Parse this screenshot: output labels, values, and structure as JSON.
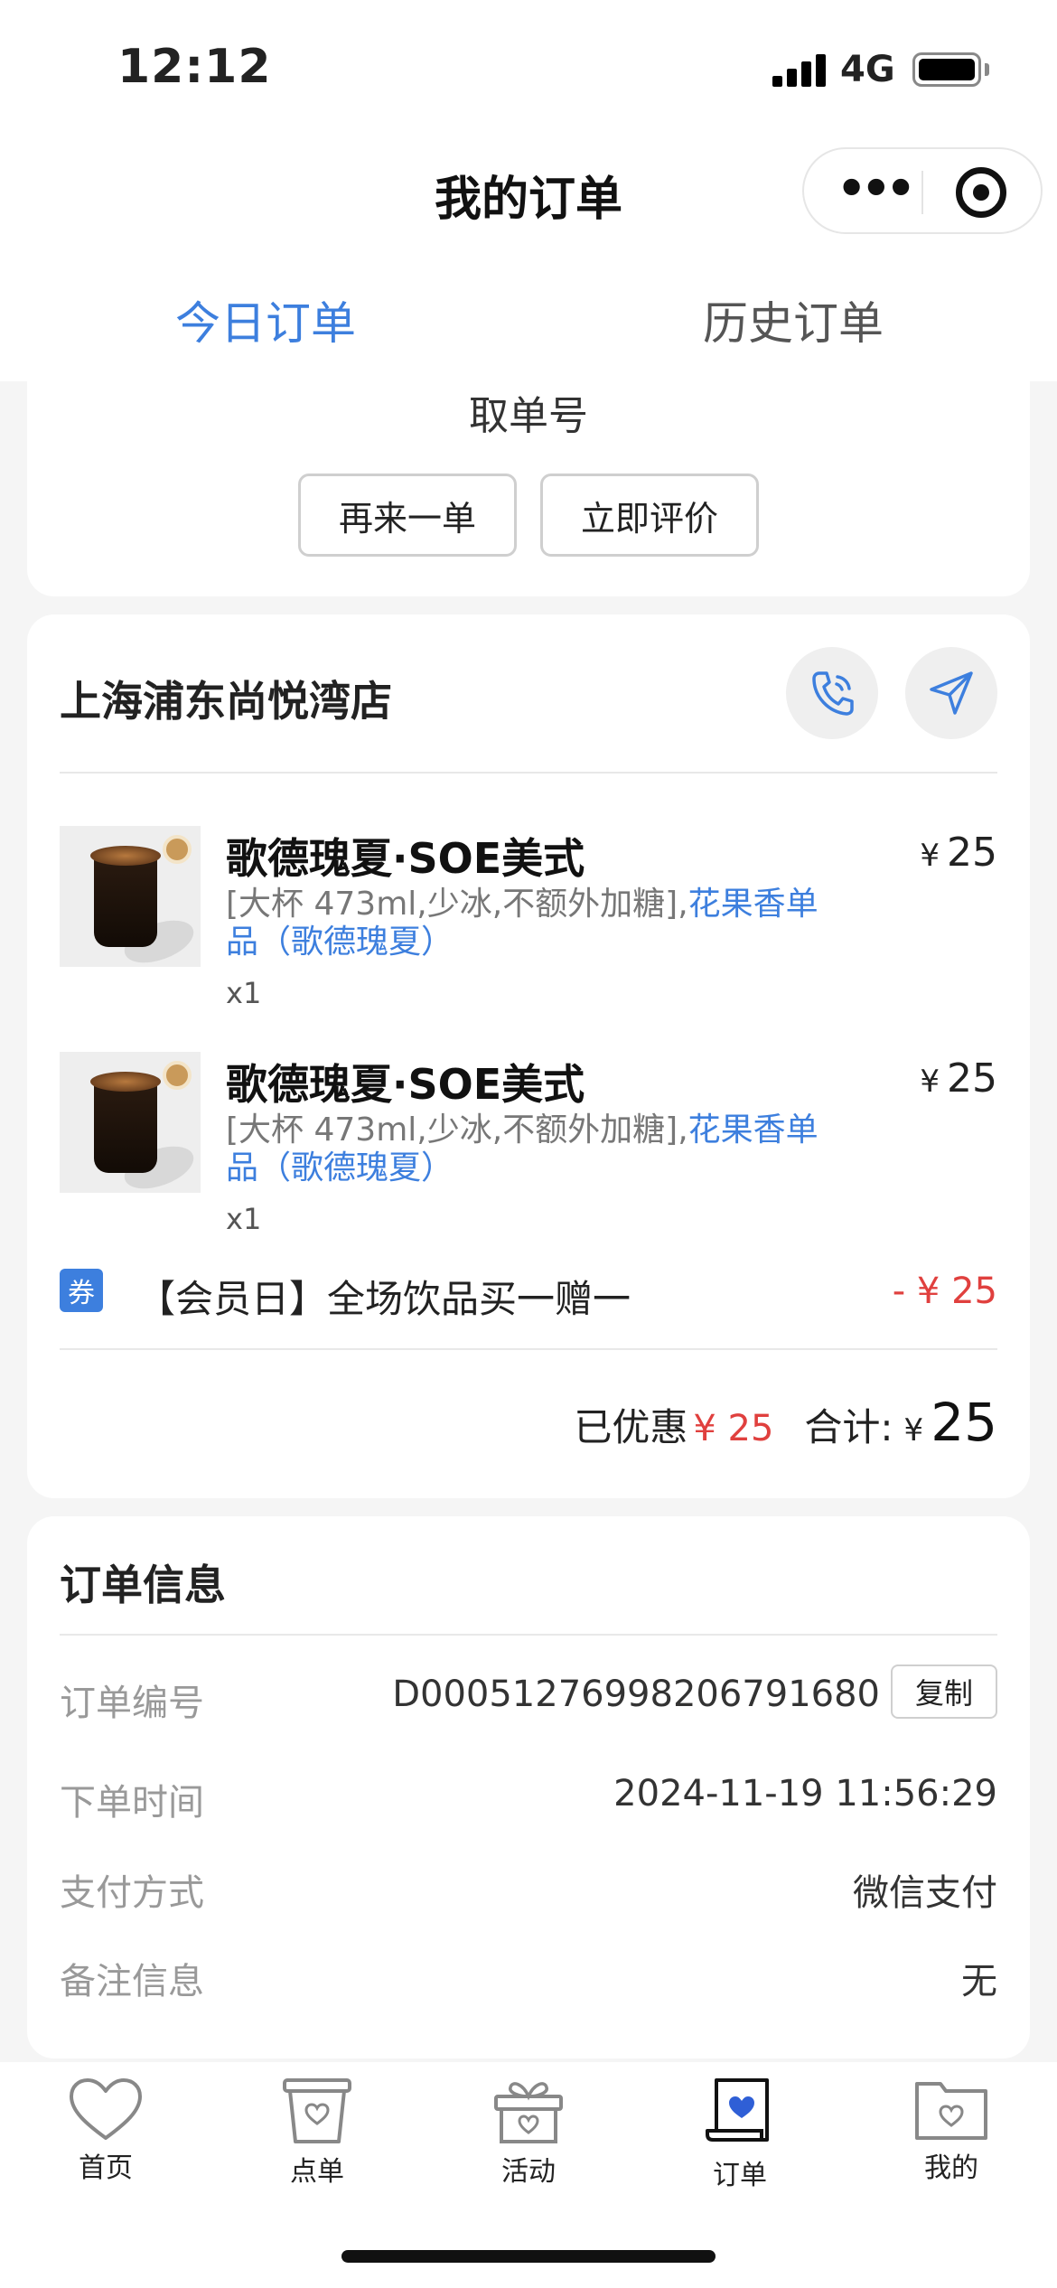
{
  "status_bar": {
    "time": "12:12",
    "network": "4G"
  },
  "nav": {
    "title": "我的订单"
  },
  "tabs": [
    {
      "label": "今日订单",
      "active": true
    },
    {
      "label": "历史订单",
      "active": false
    }
  ],
  "pickup": {
    "label": "取单号",
    "reorder_label": "再来一单",
    "review_label": "立即评价"
  },
  "store": {
    "name": "上海浦东尚悦湾店",
    "phone_icon": "phone-icon",
    "navigate_icon": "navigation-arrow-icon"
  },
  "items": [
    {
      "name": "歌德瑰夏·SOE美式",
      "price_symbol": "¥",
      "price": "25",
      "spec_prefix": "[大杯 473ml,少冰,不额外加糖],",
      "spec_highlight": "花果香单品（歌德瑰夏）",
      "qty": "x1"
    },
    {
      "name": "歌德瑰夏·SOE美式",
      "price_symbol": "¥",
      "price": "25",
      "spec_prefix": "[大杯 473ml,少冰,不额外加糖],",
      "spec_highlight": "花果香单品（歌德瑰夏）",
      "qty": "x1"
    }
  ],
  "coupon": {
    "tag": "券",
    "name": "【会员日】全场饮品买一赠一",
    "amount": "- ¥ 25"
  },
  "summary": {
    "discount_label": "已优惠",
    "discount_value": "¥ 25",
    "total_label": "合计:",
    "total_symbol": "¥",
    "total_value": "25"
  },
  "order_info": {
    "title": "订单信息",
    "rows": [
      {
        "key": "订单编号",
        "value": "D00051276998206791680"
      },
      {
        "key": "下单时间",
        "value": "2024-11-19 11:56:29"
      },
      {
        "key": "支付方式",
        "value": "微信支付"
      },
      {
        "key": "备注信息",
        "value": "无"
      }
    ],
    "copy_label": "复制"
  },
  "tabbar": [
    {
      "label": "首页",
      "icon": "heart-icon"
    },
    {
      "label": "点单",
      "icon": "cup-icon"
    },
    {
      "label": "活动",
      "icon": "gift-icon"
    },
    {
      "label": "订单",
      "icon": "order-icon",
      "active": true
    },
    {
      "label": "我的",
      "icon": "folder-icon"
    }
  ],
  "colors": {
    "accent": "#3d7fde",
    "discount": "#e0403e"
  }
}
